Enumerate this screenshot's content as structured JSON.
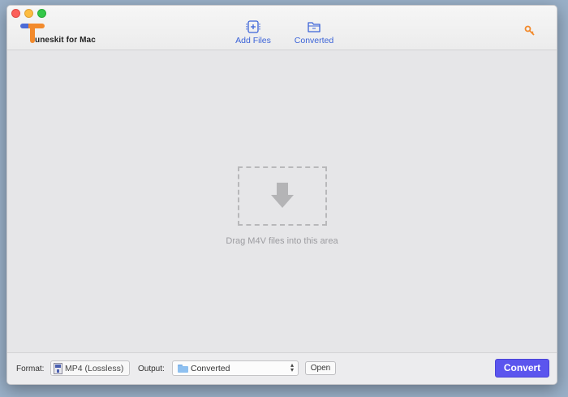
{
  "app": {
    "logo_text": "uneskit for Mac"
  },
  "toolbar": {
    "add_files_label": "Add Files",
    "converted_label": "Converted",
    "key_icon": "key-icon"
  },
  "drop_area": {
    "hint": "Drag M4V files into this area",
    "icon": "download-arrow-icon"
  },
  "bottom_bar": {
    "format_label": "Format:",
    "format_value": "MP4 (Lossless)",
    "output_label": "Output:",
    "output_value": "Converted",
    "open_label": "Open",
    "convert_label": "Convert"
  },
  "colors": {
    "accent": "#5b55ee",
    "toolbar_text": "#3b63d8",
    "logo_orange": "#f28a2c",
    "logo_blue": "#4d6bd6"
  }
}
